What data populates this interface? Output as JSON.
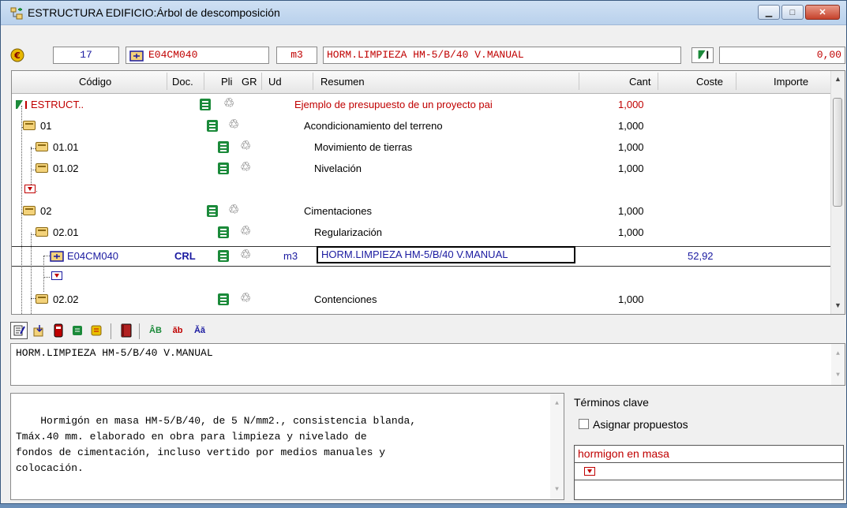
{
  "window": {
    "title": "ESTRUCTURA EDIFICIO:Árbol de descomposición",
    "minimize": "▁",
    "maximize": "□",
    "close": "✕"
  },
  "topbar": {
    "number": "17",
    "code": "E04CM040",
    "unit": "m3",
    "summary": "HORM.LIMPIEZA HM-5/B/40 V.MANUAL",
    "amount": "0,00"
  },
  "columns": {
    "codigo": "Código",
    "doc": "Doc.",
    "pli": "Pli",
    "gr": "GR",
    "ud": "Ud",
    "resumen": "Resumen",
    "cant": "Cant",
    "coste": "Coste",
    "importe": "Importe"
  },
  "rows": [
    {
      "code": "ESTRUCT..",
      "resumen": "Ejemplo de presupuesto de un proyecto pai",
      "cant": "1,000"
    },
    {
      "code": "01",
      "resumen": "Acondicionamiento del terreno",
      "cant": "1,000"
    },
    {
      "code": "01.01",
      "resumen": "Movimiento de tierras",
      "cant": "1,000"
    },
    {
      "code": "01.02",
      "resumen": "Nivelación",
      "cant": "1,000"
    },
    {
      "code": "02",
      "resumen": "Cimentaciones",
      "cant": "1,000"
    },
    {
      "code": "02.01",
      "resumen": "Regularización",
      "cant": "1,000"
    },
    {
      "code": "E04CM040",
      "doc": "CRL",
      "ud": "m3",
      "resumen": "HORM.LIMPIEZA HM-5/B/40 V.MANUAL",
      "coste": "52,92"
    },
    {
      "code": "02.02",
      "resumen": "Contenciones",
      "cant": "1,000"
    }
  ],
  "toolbar": {
    "ab_up": "ÂB",
    "ab_down": "ăb",
    "aa": "Ăă"
  },
  "short_text": "HORM.LIMPIEZA HM-5/B/40 V.MANUAL",
  "long_text": "Hormigón en masa HM-5/B/40, de 5 N/mm2., consistencia blanda,\nTmáx.40 mm. elaborado en obra para limpieza y nivelado de\nfondos de cimentación, incluso vertido por medios manuales y\ncolocación.",
  "keywords": {
    "title": "Términos clave",
    "assign_label": "Asignar propuestos",
    "items": [
      "hormigon en masa"
    ]
  }
}
